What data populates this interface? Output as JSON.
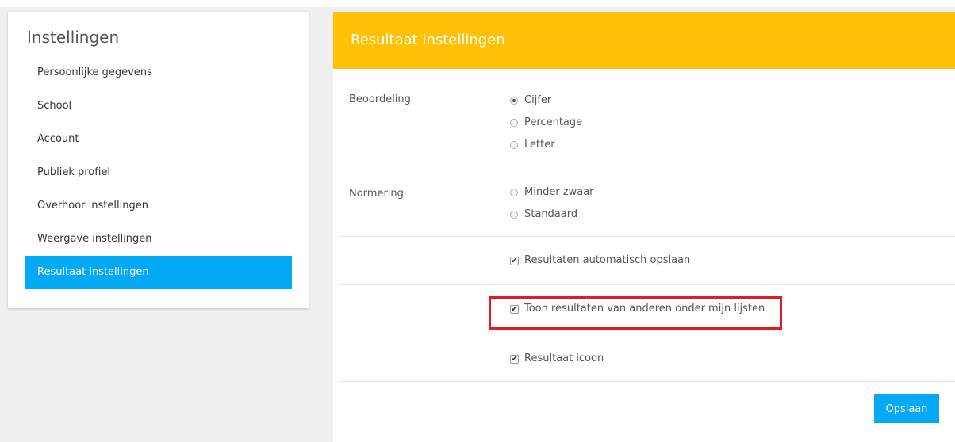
{
  "sidebar": {
    "title": "Instellingen",
    "items": [
      {
        "label": "Persoonlijke gegevens"
      },
      {
        "label": "School"
      },
      {
        "label": "Account"
      },
      {
        "label": "Publiek profiel"
      },
      {
        "label": "Overhoor instellingen"
      },
      {
        "label": "Weergave instellingen"
      },
      {
        "label": "Resultaat instellingen",
        "active": true
      }
    ]
  },
  "panel": {
    "title": "Resultaat instellingen",
    "beoordeling": {
      "label": "Beoordeling",
      "options": [
        "Cijfer",
        "Percentage",
        "Letter"
      ],
      "selected": "Cijfer"
    },
    "normering": {
      "label": "Normering",
      "options": [
        "Minder zwaar",
        "Standaard"
      ],
      "selected": null
    },
    "checkboxes": [
      {
        "label": "Resultaten automatisch opslaan",
        "checked": true
      },
      {
        "label": "Toon resultaten van anderen onder mijn lijsten",
        "checked": true,
        "highlighted": true
      },
      {
        "label": "Resultaat icoon",
        "checked": true
      }
    ],
    "save_label": "Opslaan"
  },
  "colors": {
    "header": "#ffc107",
    "accent": "#03a9f4",
    "highlight": "#e01b24"
  }
}
